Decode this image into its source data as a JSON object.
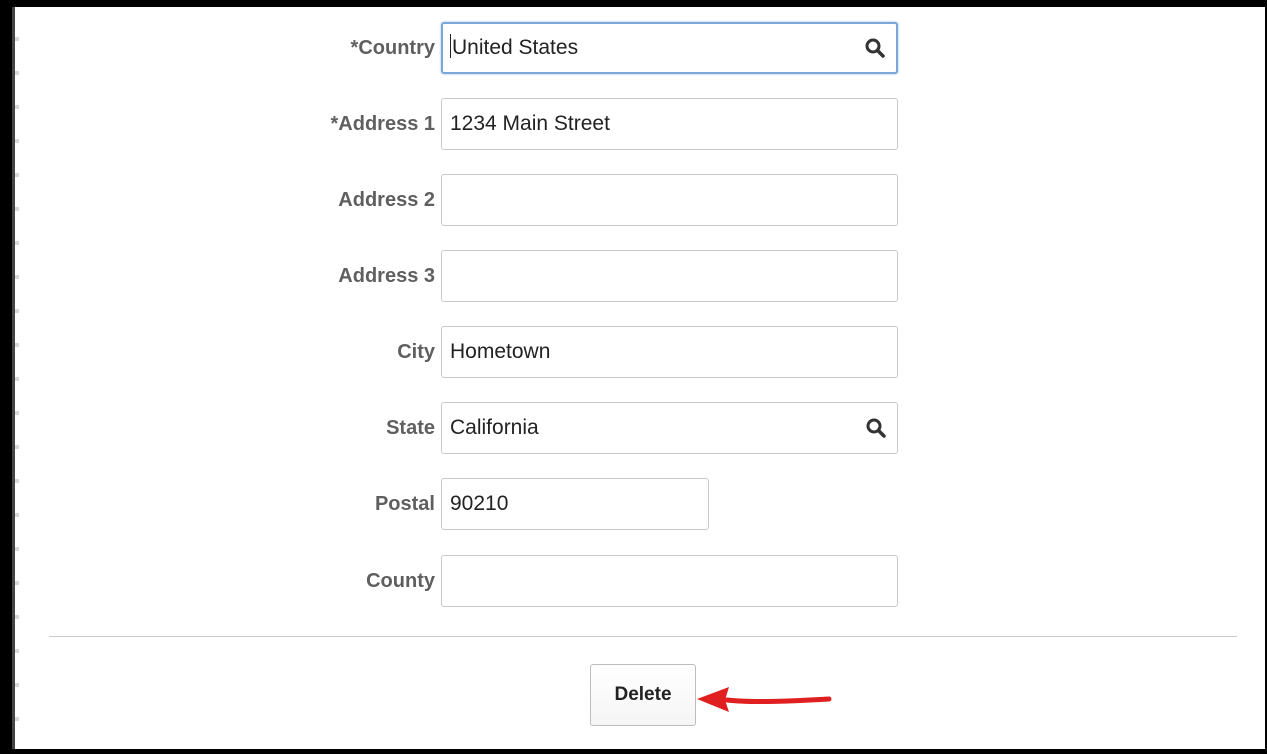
{
  "form": {
    "fields": [
      {
        "label": "*Country",
        "value": "United States",
        "has_search": true,
        "focused": true
      },
      {
        "label": "*Address 1",
        "value": "1234 Main Street",
        "has_search": false,
        "focused": false
      },
      {
        "label": "Address 2",
        "value": "",
        "has_search": false,
        "focused": false
      },
      {
        "label": "Address 3",
        "value": "",
        "has_search": false,
        "focused": false
      },
      {
        "label": "City",
        "value": "Hometown",
        "has_search": false,
        "focused": false
      },
      {
        "label": "State",
        "value": "California",
        "has_search": true,
        "focused": false
      },
      {
        "label": "Postal",
        "value": "90210",
        "has_search": false,
        "focused": false
      },
      {
        "label": "County",
        "value": "",
        "has_search": false,
        "focused": false
      }
    ]
  },
  "actions": {
    "delete_label": "Delete"
  },
  "annotation": {
    "arrow_color": "#e02020",
    "icon": "red-arrow-icon"
  },
  "colors": {
    "focus_border": "#7da7d9",
    "label_text": "#5f5f5f"
  }
}
